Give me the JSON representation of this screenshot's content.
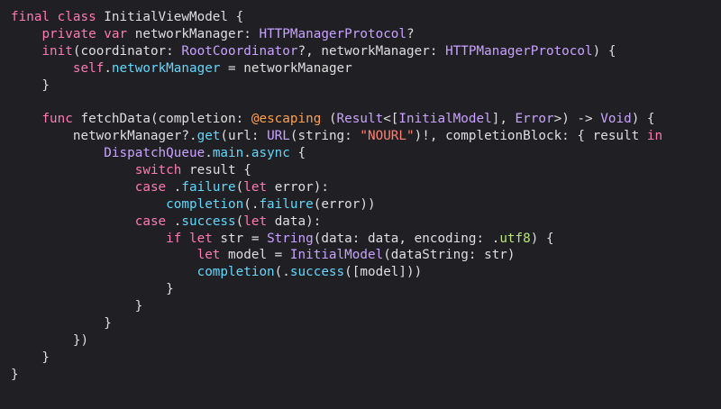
{
  "theme": {
    "background": "#1f1f24",
    "keyword": "#ff7ab2",
    "type": "#c9a2ff",
    "member": "#62d7fa",
    "string": "#ff8170",
    "plain": "#dfdfe0"
  },
  "code_lines": [
    [
      [
        "keyword",
        "final class "
      ],
      [
        "plain",
        "InitialViewModel {"
      ]
    ],
    [
      [
        "plain",
        "    "
      ],
      [
        "keyword",
        "private var "
      ],
      [
        "plain",
        "networkManager: "
      ],
      [
        "type",
        "HTTPManagerProtocol"
      ],
      [
        "plain",
        "?"
      ]
    ],
    [
      [
        "plain",
        "    "
      ],
      [
        "keyword",
        "init"
      ],
      [
        "plain",
        "(coordinator: "
      ],
      [
        "type",
        "RootCoordinator"
      ],
      [
        "plain",
        "?, networkManager: "
      ],
      [
        "type",
        "HTTPManagerProtocol"
      ],
      [
        "plain",
        ") {"
      ]
    ],
    [
      [
        "plain",
        "        "
      ],
      [
        "keyword",
        "self"
      ],
      [
        "plain",
        "."
      ],
      [
        "member",
        "networkManager"
      ],
      [
        "plain",
        " = networkManager"
      ]
    ],
    [
      [
        "plain",
        "    }"
      ]
    ],
    [
      [
        "plain",
        ""
      ]
    ],
    [
      [
        "plain",
        "    "
      ],
      [
        "keyword",
        "func "
      ],
      [
        "plain",
        "fetchData(completion: "
      ],
      [
        "at",
        "@escaping "
      ],
      [
        "plain",
        "("
      ],
      [
        "type",
        "Result"
      ],
      [
        "plain",
        "<["
      ],
      [
        "type",
        "InitialModel"
      ],
      [
        "plain",
        "], "
      ],
      [
        "type",
        "Error"
      ],
      [
        "plain",
        ">) -> "
      ],
      [
        "type",
        "Void"
      ],
      [
        "plain",
        ") {"
      ]
    ],
    [
      [
        "plain",
        "        networkManager?."
      ],
      [
        "member",
        "get"
      ],
      [
        "plain",
        "(url: "
      ],
      [
        "type",
        "URL"
      ],
      [
        "plain",
        "(string: "
      ],
      [
        "string",
        "\"NOURL\""
      ],
      [
        "plain",
        ")!, completionBlock: { result "
      ],
      [
        "keyword",
        "in"
      ]
    ],
    [
      [
        "plain",
        "            "
      ],
      [
        "type",
        "DispatchQueue"
      ],
      [
        "plain",
        "."
      ],
      [
        "member",
        "main"
      ],
      [
        "plain",
        "."
      ],
      [
        "member",
        "async"
      ],
      [
        "plain",
        " {"
      ]
    ],
    [
      [
        "plain",
        "                "
      ],
      [
        "keyword",
        "switch"
      ],
      [
        "plain",
        " result {"
      ]
    ],
    [
      [
        "plain",
        "                "
      ],
      [
        "keyword",
        "case"
      ],
      [
        "plain",
        " ."
      ],
      [
        "member",
        "failure"
      ],
      [
        "plain",
        "("
      ],
      [
        "keyword",
        "let"
      ],
      [
        "plain",
        " error):"
      ]
    ],
    [
      [
        "plain",
        "                    "
      ],
      [
        "member",
        "completion"
      ],
      [
        "plain",
        "(."
      ],
      [
        "member",
        "failure"
      ],
      [
        "plain",
        "(error))"
      ]
    ],
    [
      [
        "plain",
        "                "
      ],
      [
        "keyword",
        "case"
      ],
      [
        "plain",
        " ."
      ],
      [
        "member",
        "success"
      ],
      [
        "plain",
        "("
      ],
      [
        "keyword",
        "let"
      ],
      [
        "plain",
        " data):"
      ]
    ],
    [
      [
        "plain",
        "                    "
      ],
      [
        "keyword",
        "if let"
      ],
      [
        "plain",
        " str = "
      ],
      [
        "type",
        "String"
      ],
      [
        "plain",
        "(data: data, encoding: ."
      ],
      [
        "green",
        "utf8"
      ],
      [
        "plain",
        ") {"
      ]
    ],
    [
      [
        "plain",
        "                        "
      ],
      [
        "keyword",
        "let"
      ],
      [
        "plain",
        " model = "
      ],
      [
        "type",
        "InitialModel"
      ],
      [
        "plain",
        "(dataString: str)"
      ]
    ],
    [
      [
        "plain",
        "                        "
      ],
      [
        "member",
        "completion"
      ],
      [
        "plain",
        "(."
      ],
      [
        "member",
        "success"
      ],
      [
        "plain",
        "([model]))"
      ]
    ],
    [
      [
        "plain",
        "                    }"
      ]
    ],
    [
      [
        "plain",
        "                }"
      ]
    ],
    [
      [
        "plain",
        "            }"
      ]
    ],
    [
      [
        "plain",
        "        })"
      ]
    ],
    [
      [
        "plain",
        "    }"
      ]
    ],
    [
      [
        "plain",
        "}"
      ]
    ]
  ]
}
